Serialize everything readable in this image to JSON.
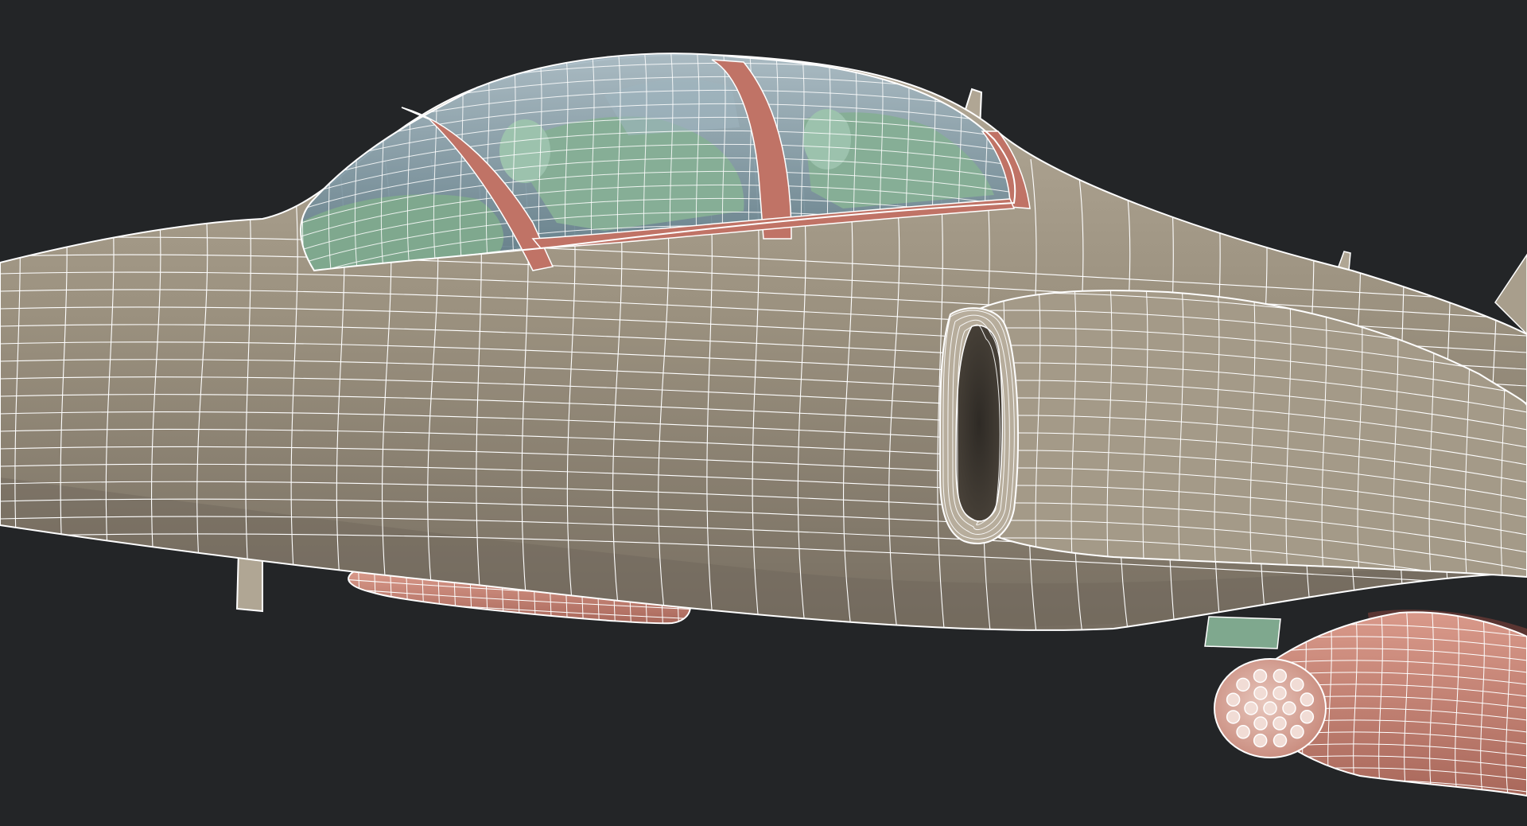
{
  "scene": {
    "subject": "",
    "background_color": "#232527",
    "colors": {
      "hull": "#9a8f7e",
      "hull_light": "#b5ab9a",
      "hull_dark": "#6f665a",
      "canopy_glass": "#7e9aa8",
      "interior_green": "#7fa88e",
      "frame_red": "#c07366",
      "pod_red": "#c98474",
      "wire": "#ffffff",
      "intake_dark": "#3a352f"
    }
  }
}
